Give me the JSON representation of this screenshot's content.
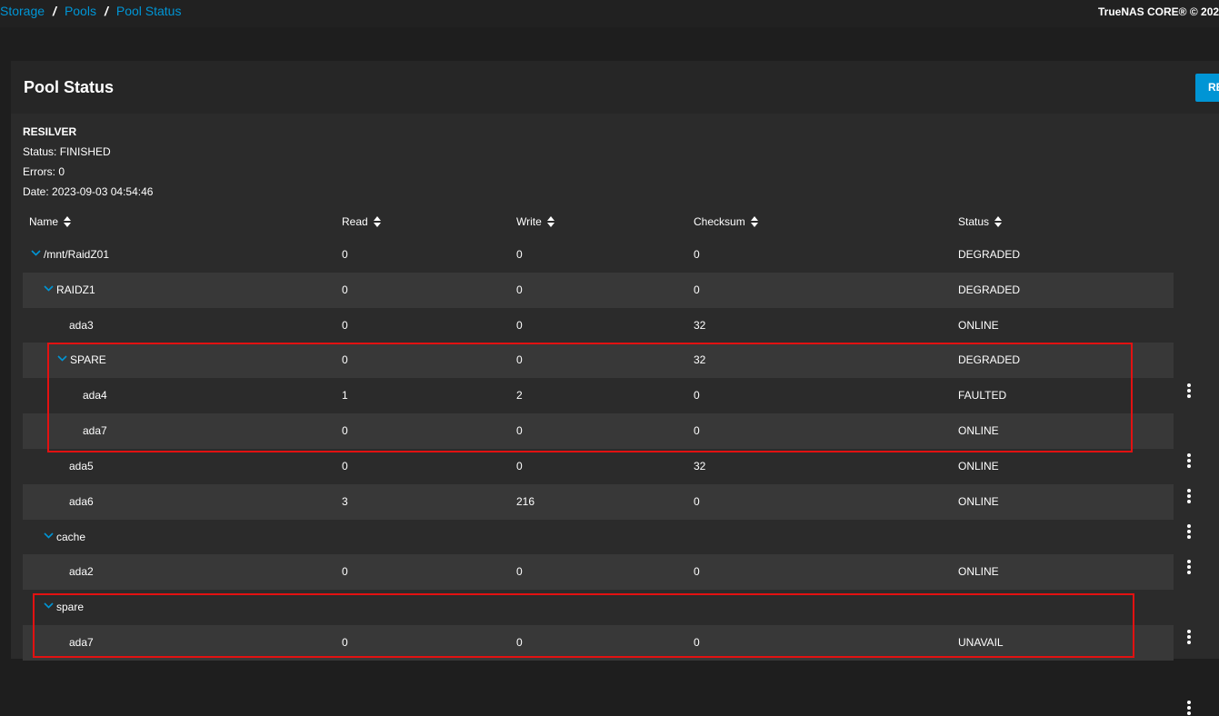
{
  "breadcrumb": {
    "items": [
      "Storage",
      "Pools",
      "Pool Status"
    ],
    "separator": "/"
  },
  "product": "TrueNAS CORE® © 202",
  "card": {
    "title": "Pool Status",
    "action_label": "RE"
  },
  "scan": {
    "title": "RESILVER",
    "status": "Status: FINISHED",
    "errors": "Errors: 0",
    "date": "Date: 2023-09-03 04:54:46"
  },
  "table": {
    "columns": [
      "Name",
      "Read",
      "Write",
      "Checksum",
      "Status"
    ],
    "rows": [
      {
        "name": "/mnt/RaidZ01",
        "read": "0",
        "write": "0",
        "checksum": "0",
        "status": "DEGRADED"
      },
      {
        "name": "RAIDZ1",
        "read": "0",
        "write": "0",
        "checksum": "0",
        "status": "DEGRADED"
      },
      {
        "name": "ada3",
        "read": "0",
        "write": "0",
        "checksum": "32",
        "status": "ONLINE"
      },
      {
        "name": "SPARE",
        "read": "0",
        "write": "0",
        "checksum": "32",
        "status": "DEGRADED"
      },
      {
        "name": "ada4",
        "read": "1",
        "write": "2",
        "checksum": "0",
        "status": "FAULTED"
      },
      {
        "name": "ada7",
        "read": "0",
        "write": "0",
        "checksum": "0",
        "status": "ONLINE"
      },
      {
        "name": "ada5",
        "read": "0",
        "write": "0",
        "checksum": "32",
        "status": "ONLINE"
      },
      {
        "name": "ada6",
        "read": "3",
        "write": "216",
        "checksum": "0",
        "status": "ONLINE"
      },
      {
        "name": "cache",
        "read": "",
        "write": "",
        "checksum": "",
        "status": ""
      },
      {
        "name": "ada2",
        "read": "0",
        "write": "0",
        "checksum": "0",
        "status": "ONLINE"
      },
      {
        "name": "spare",
        "read": "",
        "write": "",
        "checksum": "",
        "status": ""
      },
      {
        "name": "ada7",
        "read": "0",
        "write": "0",
        "checksum": "0",
        "status": "UNAVAIL"
      }
    ]
  },
  "icons": {
    "expand": "chevron-down-icon",
    "sort": "sort-icon",
    "actions": "more-vert-icon"
  },
  "colors": {
    "accent": "#0095d5",
    "highlight_box": "#e21111"
  }
}
